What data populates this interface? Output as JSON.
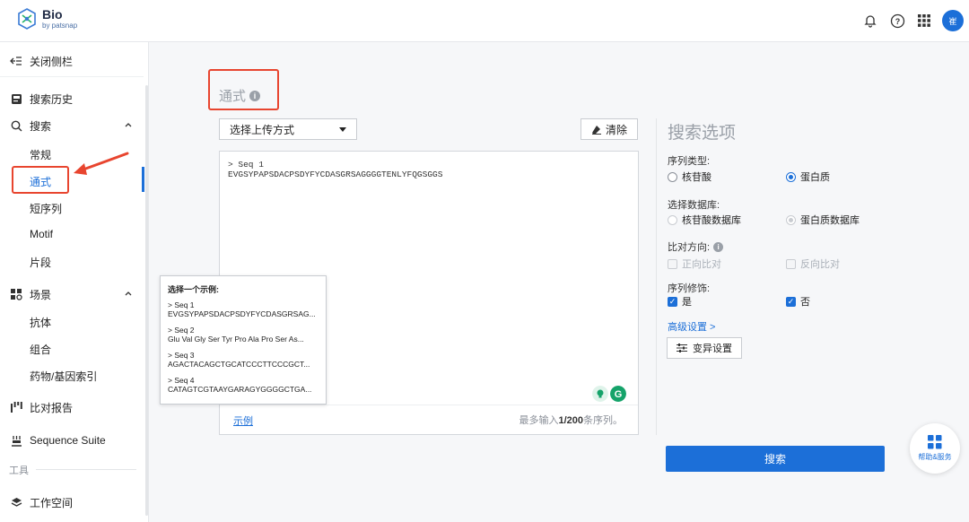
{
  "app": {
    "logo_title": "Bio",
    "logo_sub": "by patsnap",
    "avatar_text": "崔"
  },
  "colors": {
    "accent": "#1c6fd8",
    "annotation_red": "#e8452f",
    "muted_text": "#9aa0a8"
  },
  "topbar": {
    "icons": [
      "bell-icon",
      "help-circle-icon",
      "apps-grid-icon"
    ]
  },
  "sidebar": {
    "collapse_label": "关闭侧栏",
    "history_label": "搜索历史",
    "search_label": "搜索",
    "search_items": [
      "常规",
      "通式",
      "短序列",
      "Motif",
      "片段"
    ],
    "scenes_label": "场景",
    "scene_items": [
      "抗体",
      "组合",
      "药物/基因索引"
    ],
    "compare_label": "比对报告",
    "suite_label": "Sequence Suite",
    "tools_label": "工具",
    "workspace_label": "工作空间"
  },
  "main": {
    "title": "通式",
    "upload_select": "选择上传方式",
    "clear_label": "清除",
    "sequence_text": "> Seq 1\nEVGSYPAPSDACPSDYFYCDASGRSAGGGGTENLYFQGSGGS",
    "example_link": "示例",
    "limit_prefix": "最多输入",
    "limit_value": "1/200",
    "limit_suffix": "条序列。"
  },
  "example_popup": {
    "title": "选择一个示例:",
    "items": [
      {
        "name": "> Seq 1",
        "seq": "EVGSYPAPSDACPSDYFYCDASGRSAG..."
      },
      {
        "name": "> Seq 2",
        "seq": "Glu Val Gly Ser Tyr Pro Ala Pro Ser As..."
      },
      {
        "name": "> Seq 3",
        "seq": "AGACTACAGCTGCATCCCTTCCCGCT..."
      },
      {
        "name": "> Seq 4",
        "seq": "CATAGTCGTAAYGARAGYGGGGCTGA..."
      }
    ]
  },
  "options": {
    "title": "搜索选项",
    "seq_type_label": "序列类型:",
    "seq_type_nucleotide": "核苷酸",
    "seq_type_protein": "蛋白质",
    "seq_type_selected": "蛋白质",
    "db_label": "选择数据库:",
    "db_nucleotide": "核苷酸数据库",
    "db_protein": "蛋白质数据库",
    "direction_label": "比对方向:",
    "direction_forward": "正向比对",
    "direction_reverse": "反向比对",
    "modify_label": "序列修饰:",
    "modify_yes": "是",
    "modify_no": "否",
    "advanced_link": "高级设置 >",
    "mutation_button": "变异设置",
    "search_button": "搜索"
  },
  "help": {
    "label": "帮助&服务"
  }
}
